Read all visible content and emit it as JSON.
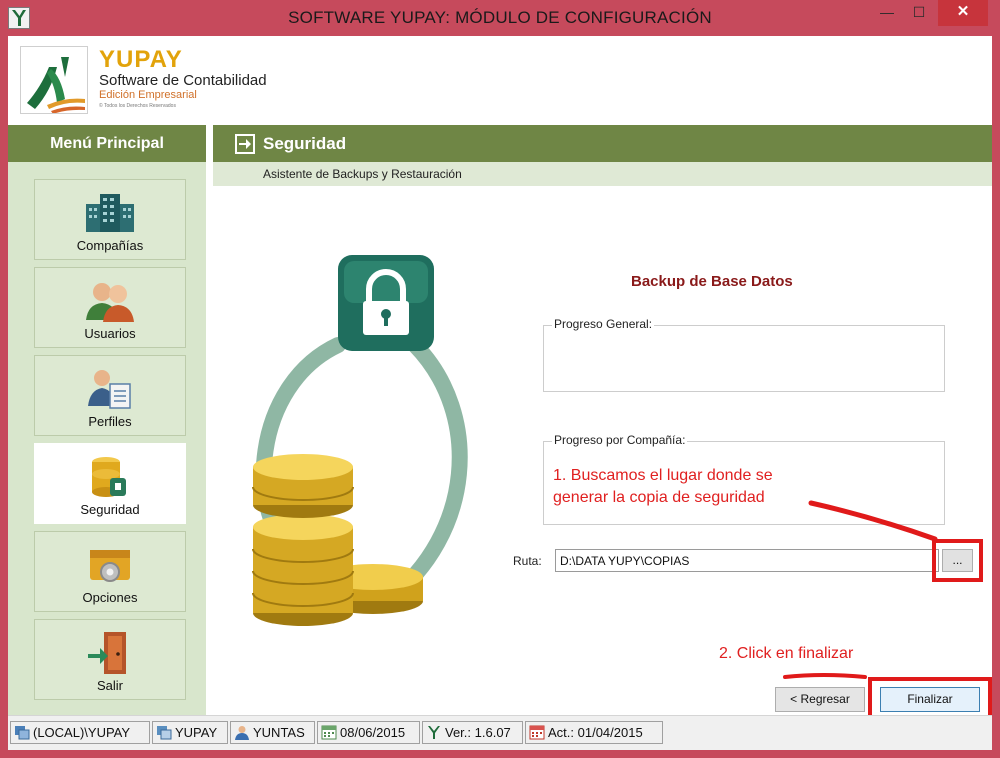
{
  "window": {
    "title": "SOFTWARE YUPAY: MÓDULO DE CONFIGURACIÓN",
    "minimize_glyph": "—",
    "maximize_glyph": "☐",
    "close_glyph": "✕"
  },
  "header": {
    "brand_name": "YUPAY",
    "subtitle": "Software de Contabilidad",
    "edition": "Edición Empresarial",
    "rights": "© Todos los Derechos Reservados"
  },
  "sidebar": {
    "title": "Menú Principal",
    "items": [
      {
        "label": "Compañías",
        "icon": "buildings-icon"
      },
      {
        "label": "Usuarios",
        "icon": "users-icon"
      },
      {
        "label": "Perfiles",
        "icon": "profile-icon"
      },
      {
        "label": "Seguridad",
        "icon": "database-lock-icon",
        "active": true
      },
      {
        "label": "Opciones",
        "icon": "settings-icon"
      },
      {
        "label": "Salir",
        "icon": "exit-door-icon"
      }
    ]
  },
  "main": {
    "title": "Seguridad",
    "subtitle": "Asistente de Backups y Restauración",
    "backup_title": "Backup de Base Datos",
    "group_general_label": "Progreso General:",
    "group_company_label": "Progreso por Compañía:",
    "ruta_label": "Ruta:",
    "ruta_value": "D:\\DATA YUPY\\COPIAS",
    "browse_label": "...",
    "back_label": "< Regresar",
    "finish_label": "Finalizar"
  },
  "annotations": {
    "note1_line1": "1. Buscamos el lugar donde se",
    "note1_line2": "generar la copia de seguridad",
    "note2": "2. Click en finalizar",
    "color": "#e02020"
  },
  "statusbar": {
    "server": "(LOCAL)\\YUPAY",
    "database": "YUPAY",
    "user": "YUNTAS",
    "date": "08/06/2015",
    "version": "Ver.: 1.6.07",
    "updated": "Act.: 01/04/2015"
  },
  "colors": {
    "title_bar": "#c64a5c",
    "accent_green": "#6f8645",
    "sidebar_bg": "#d8e6cc",
    "brand_gold": "#e2a30b",
    "backup_title": "#8a1a1a"
  }
}
